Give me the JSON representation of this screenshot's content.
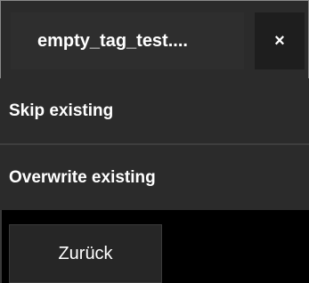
{
  "tab": {
    "title": "empty_tag_test....",
    "close_glyph": "×"
  },
  "menu": {
    "items": [
      {
        "label": "Skip existing"
      },
      {
        "label": "Overwrite existing"
      }
    ]
  },
  "footer": {
    "back_label": "Zurück"
  }
}
